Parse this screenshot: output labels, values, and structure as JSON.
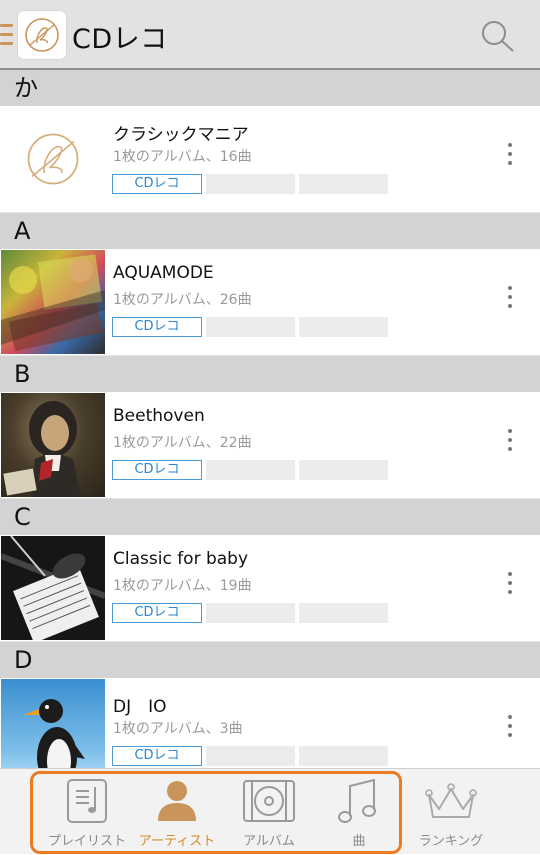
{
  "header": {
    "title": "CDレコ",
    "accent_color": "#c9955a"
  },
  "sections": [
    {
      "letter": "か",
      "artist": {
        "name": "クラシックマニア",
        "meta": "1枚のアルバム、16曲",
        "tag": "CDレコ",
        "thumb": "cdreco-logo"
      }
    },
    {
      "letter": "A",
      "artist": {
        "name": "AQUAMODE",
        "meta": "1枚のアルバム、26曲",
        "tag": "CDレコ",
        "thumb": "album-art-collage"
      }
    },
    {
      "letter": "B",
      "artist": {
        "name": "Beethoven",
        "meta": "1枚のアルバム、22曲",
        "tag": "CDレコ",
        "thumb": "beethoven-portrait"
      }
    },
    {
      "letter": "C",
      "artist": {
        "name": "Classic for baby",
        "meta": "1枚のアルバム、19曲",
        "tag": "CDレコ",
        "thumb": "violin-sheet-music-photo"
      }
    },
    {
      "letter": "D",
      "artist": {
        "name": "DJ　IO",
        "meta": "1枚のアルバム、3曲",
        "tag": "CDレコ",
        "thumb": "penguin-photo"
      }
    }
  ],
  "bottom_nav": {
    "items": [
      {
        "label": "プレイリスト",
        "icon": "playlist-icon",
        "active": false
      },
      {
        "label": "アーティスト",
        "icon": "person-icon",
        "active": true
      },
      {
        "label": "アルバム",
        "icon": "album-icon",
        "active": false
      },
      {
        "label": "曲",
        "icon": "music-note-icon",
        "active": false
      },
      {
        "label": "ランキング",
        "icon": "crown-icon",
        "active": false
      }
    ],
    "highlight_color": "#ea7b22",
    "active_color": "#d38a2a"
  }
}
